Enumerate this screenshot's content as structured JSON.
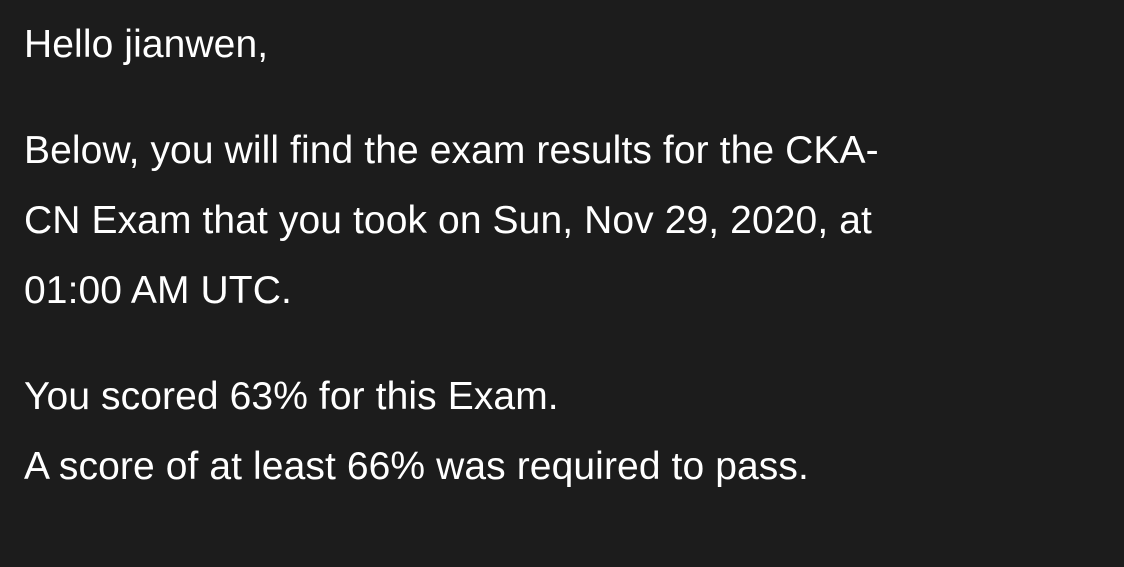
{
  "email": {
    "greeting": "Hello jianwen,",
    "results_lines": [
      "Below, you will find the exam results for the CKA-",
      "CN Exam that you took on Sun, Nov 29, 2020, at",
      "01:00 AM UTC."
    ],
    "score_line": "You scored 63% for this Exam.",
    "requirement_line": "A score of at least 66% was required to pass."
  }
}
